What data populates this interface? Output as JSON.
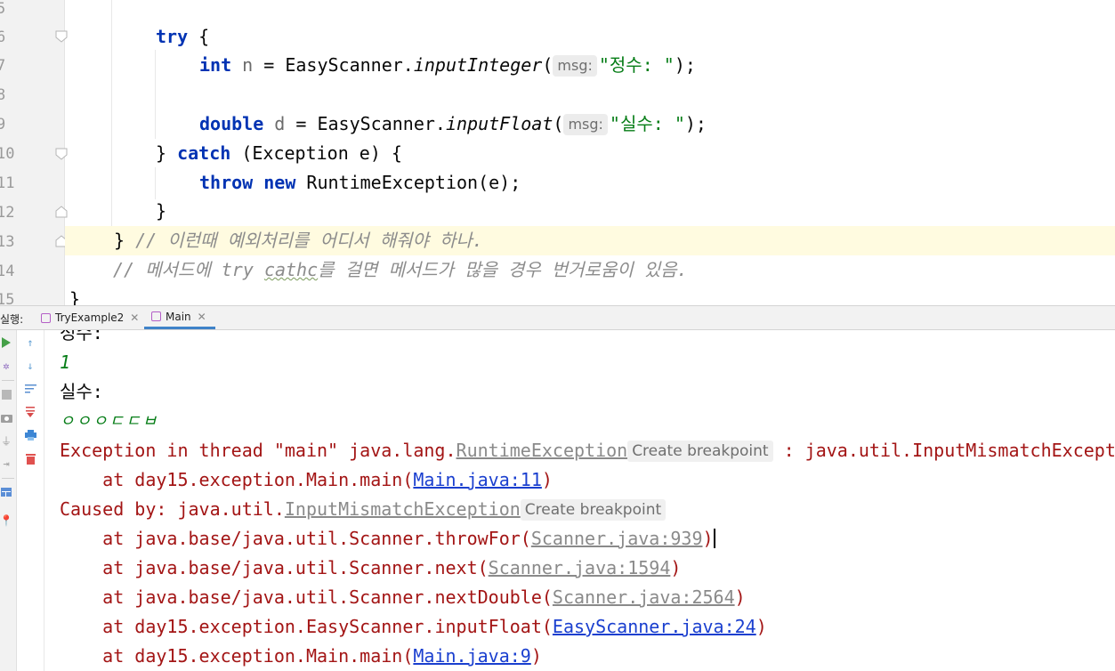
{
  "editor": {
    "line_numbers": [
      "5",
      "6",
      "7",
      "8",
      "9",
      "10",
      "11",
      "12",
      "13",
      "14",
      "15"
    ],
    "kw_try": "try",
    "brace_open": " {",
    "kw_int": "int",
    "var_n": "n",
    "assign": " = EasyScanner.",
    "method_inputInteger": "inputInteger",
    "paren_open": "(",
    "hint_msg": "msg:",
    "str_int": "\"정수: \"",
    "close_stmt": ");",
    "kw_double": "double",
    "var_d": "d",
    "method_inputFloat": "inputFloat",
    "str_float": "\"실수: \"",
    "brace_close": "}",
    "kw_catch": "catch",
    "catch_params": " (Exception e) {",
    "kw_throw": "throw",
    "kw_new": "new",
    "throw_body": " RuntimeException(e);",
    "comment13": "// 이런때 예외처리를 어디서 해줘야 하나.",
    "comment14_a": "// 메서드에 try ",
    "comment14_typo": "cathc",
    "comment14_b": "를 걸면 메서드가 많을 경우 번거로움이 있음."
  },
  "run": {
    "label": "실행:",
    "tabs": [
      {
        "label": "TryExample2"
      },
      {
        "label": "Main"
      }
    ],
    "icons": {
      "left": [
        "run-icon",
        "settings-icon",
        "stop-icon",
        "camera-icon",
        "plug-icon",
        "exit-icon",
        "layout-icon",
        "pin-icon"
      ],
      "right": [
        "up-icon",
        "down-icon",
        "soft-wrap-icon",
        "scroll-to-end-icon",
        "print-icon",
        "trash-icon"
      ]
    }
  },
  "console": {
    "prompt_int": "정수:",
    "input_int": "1",
    "prompt_float": "실수:",
    "input_float": "ㅇㅇㅇㄷㄷㅂ",
    "exc_prefix": "Exception in thread \"main\" java.lang.",
    "exc_class": "RuntimeException",
    "create_bp": "Create breakpoint",
    "exc_suffix": " : java.util.InputMismatchExceptio",
    "caused_prefix": "Caused by: java.util.",
    "caused_class": "InputMismatchException",
    "at": "    at ",
    "frames": [
      {
        "method": "day15.exception.Main.main(",
        "loc": "Main.java:11",
        "kind": "link"
      },
      {
        "method": "java.base/java.util.Scanner.throwFor(",
        "loc": "Scanner.java:939",
        "kind": "grey"
      },
      {
        "method": "java.base/java.util.Scanner.next(",
        "loc": "Scanner.java:1594",
        "kind": "grey"
      },
      {
        "method": "java.base/java.util.Scanner.nextDouble(",
        "loc": "Scanner.java:2564",
        "kind": "grey"
      },
      {
        "method": "day15.exception.EasyScanner.inputFloat(",
        "loc": "EasyScanner.java:24",
        "kind": "link"
      },
      {
        "method": "day15.exception.Main.main(",
        "loc": "Main.java:9",
        "kind": "link"
      }
    ],
    "close_paren": ")"
  },
  "colors": {
    "keyword": "#0033b3",
    "string": "#067d17",
    "comment": "#8c8c8c",
    "error": "#a31515",
    "link": "#1a3fcf",
    "tab_accent": "#4083c9"
  }
}
